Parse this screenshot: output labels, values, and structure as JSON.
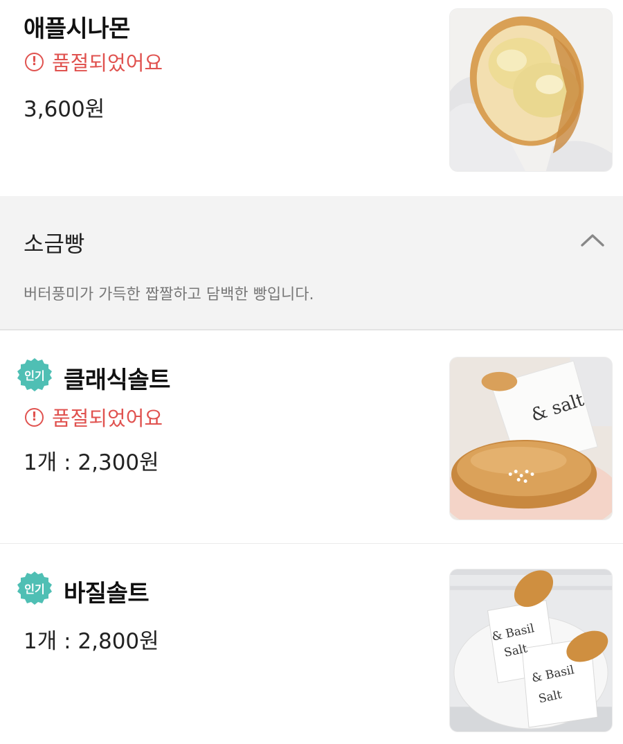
{
  "items": [
    {
      "name": "애플시나몬",
      "soldout": "품절되었어요",
      "price": "3,600원",
      "image": "apple-cinnamon-bread-photo"
    },
    {
      "badge": "인기",
      "name": "클래식솔트",
      "soldout": "품절되었어요",
      "price": "1개 : 2,300원",
      "image": "classic-salt-bread-photo"
    },
    {
      "badge": "인기",
      "name": "바질솔트",
      "price": "1개 : 2,800원",
      "image": "basil-salt-bread-photo"
    }
  ],
  "category": {
    "title": "소금빵",
    "description": "버터풍미가 가득한 짭짤하고 담백한 빵입니다.",
    "icon": "chevron-up-icon"
  },
  "photo_text": {
    "classic_bag": "& salt",
    "basil_bag_1_line1": "& Basil",
    "basil_bag_1_line2": "Salt",
    "basil_bag_2_line1": "& Basil",
    "basil_bag_2_line2": "Salt"
  },
  "colors": {
    "soldout": "#e0524f",
    "badge": "#4fbfb4",
    "category_bg": "#f3f3f3"
  }
}
